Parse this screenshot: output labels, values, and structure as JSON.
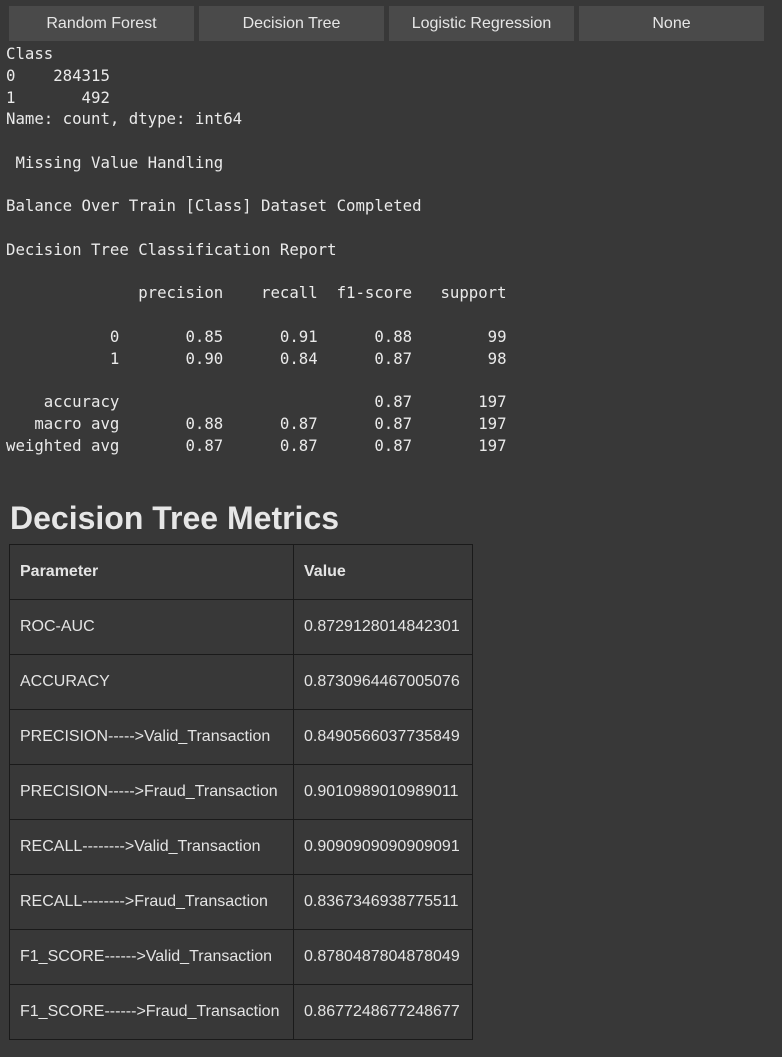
{
  "toolbar": {
    "buttons": [
      "Random Forest",
      "Decision Tree",
      "Logistic Regression",
      "None"
    ]
  },
  "console": {
    "lines": [
      "Class",
      "0    284315",
      "1       492",
      "Name: count, dtype: int64",
      "",
      " Missing Value Handling",
      "",
      "Balance Over Train [Class] Dataset Completed",
      "",
      "Decision Tree Classification Report",
      "",
      "              precision    recall  f1-score   support",
      "",
      "           0       0.85      0.91      0.88        99",
      "           1       0.90      0.84      0.87        98",
      "",
      "    accuracy                           0.87       197",
      "   macro avg       0.88      0.87      0.87       197",
      "weighted avg       0.87      0.87      0.87       197"
    ]
  },
  "metrics": {
    "title": "Decision Tree Metrics",
    "headers": [
      "Parameter",
      "Value"
    ],
    "rows": [
      [
        "ROC-AUC",
        "0.8729128014842301"
      ],
      [
        "ACCURACY",
        "0.8730964467005076"
      ],
      [
        "PRECISION----->Valid_Transaction",
        "0.8490566037735849"
      ],
      [
        "PRECISION----->Fraud_Transaction",
        "0.9010989010989011"
      ],
      [
        "RECALL-------->Valid_Transaction",
        "0.9090909090909091"
      ],
      [
        "RECALL-------->Fraud_Transaction",
        "0.8367346938775511"
      ],
      [
        "F1_SCORE------>Valid_Transaction",
        "0.8780487804878049"
      ],
      [
        "F1_SCORE------>Fraud_Transaction",
        "0.8677248677248677"
      ]
    ]
  }
}
